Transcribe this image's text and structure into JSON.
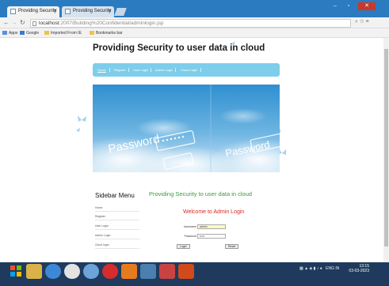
{
  "browser": {
    "tabs": [
      {
        "title": "Providing Security"
      },
      {
        "title": "Providing Security"
      }
    ],
    "url_host": "localhost",
    "url_path": ":2007/Building%20Confidential/adminlogin.jsp",
    "bookmarks": [
      {
        "label": "Apps",
        "icon": "apps-icon"
      },
      {
        "label": "Google",
        "icon": "google-icon"
      },
      {
        "label": "Imported From IE",
        "icon": "folder-icon"
      },
      {
        "label": "Bookmarks bar",
        "icon": "folder-icon"
      }
    ]
  },
  "site": {
    "title": "Providing Security to user data in cloud",
    "nav": [
      "Home",
      "Register",
      "User Login",
      "Admin Login",
      "Cloud Login"
    ]
  },
  "sidebar": {
    "title": "Sidebar Menu",
    "items": [
      "Home",
      "Register",
      "User Login",
      "Admin Login",
      "Cloud login"
    ]
  },
  "banner": {
    "word": "Password"
  },
  "content": {
    "title": "Providing Security to user data in cloud",
    "login_title": "Welcome to Admin Login",
    "username_label": "Username",
    "username_value": "admin",
    "password_label": "Password",
    "password_value": "•••••",
    "login_button": "Login",
    "reset_button": "Reset"
  },
  "taskbar": {
    "lang": "ENG",
    "region": "IN",
    "time": "13:15",
    "date": "03-03-2023"
  },
  "colors": {
    "chrome_blue": "#2b7bc0",
    "nav_bar": "#7ecdeb",
    "content_title": "#3c9a3c",
    "login_title": "#d42a1f",
    "taskbar": "#1f3a5c"
  }
}
